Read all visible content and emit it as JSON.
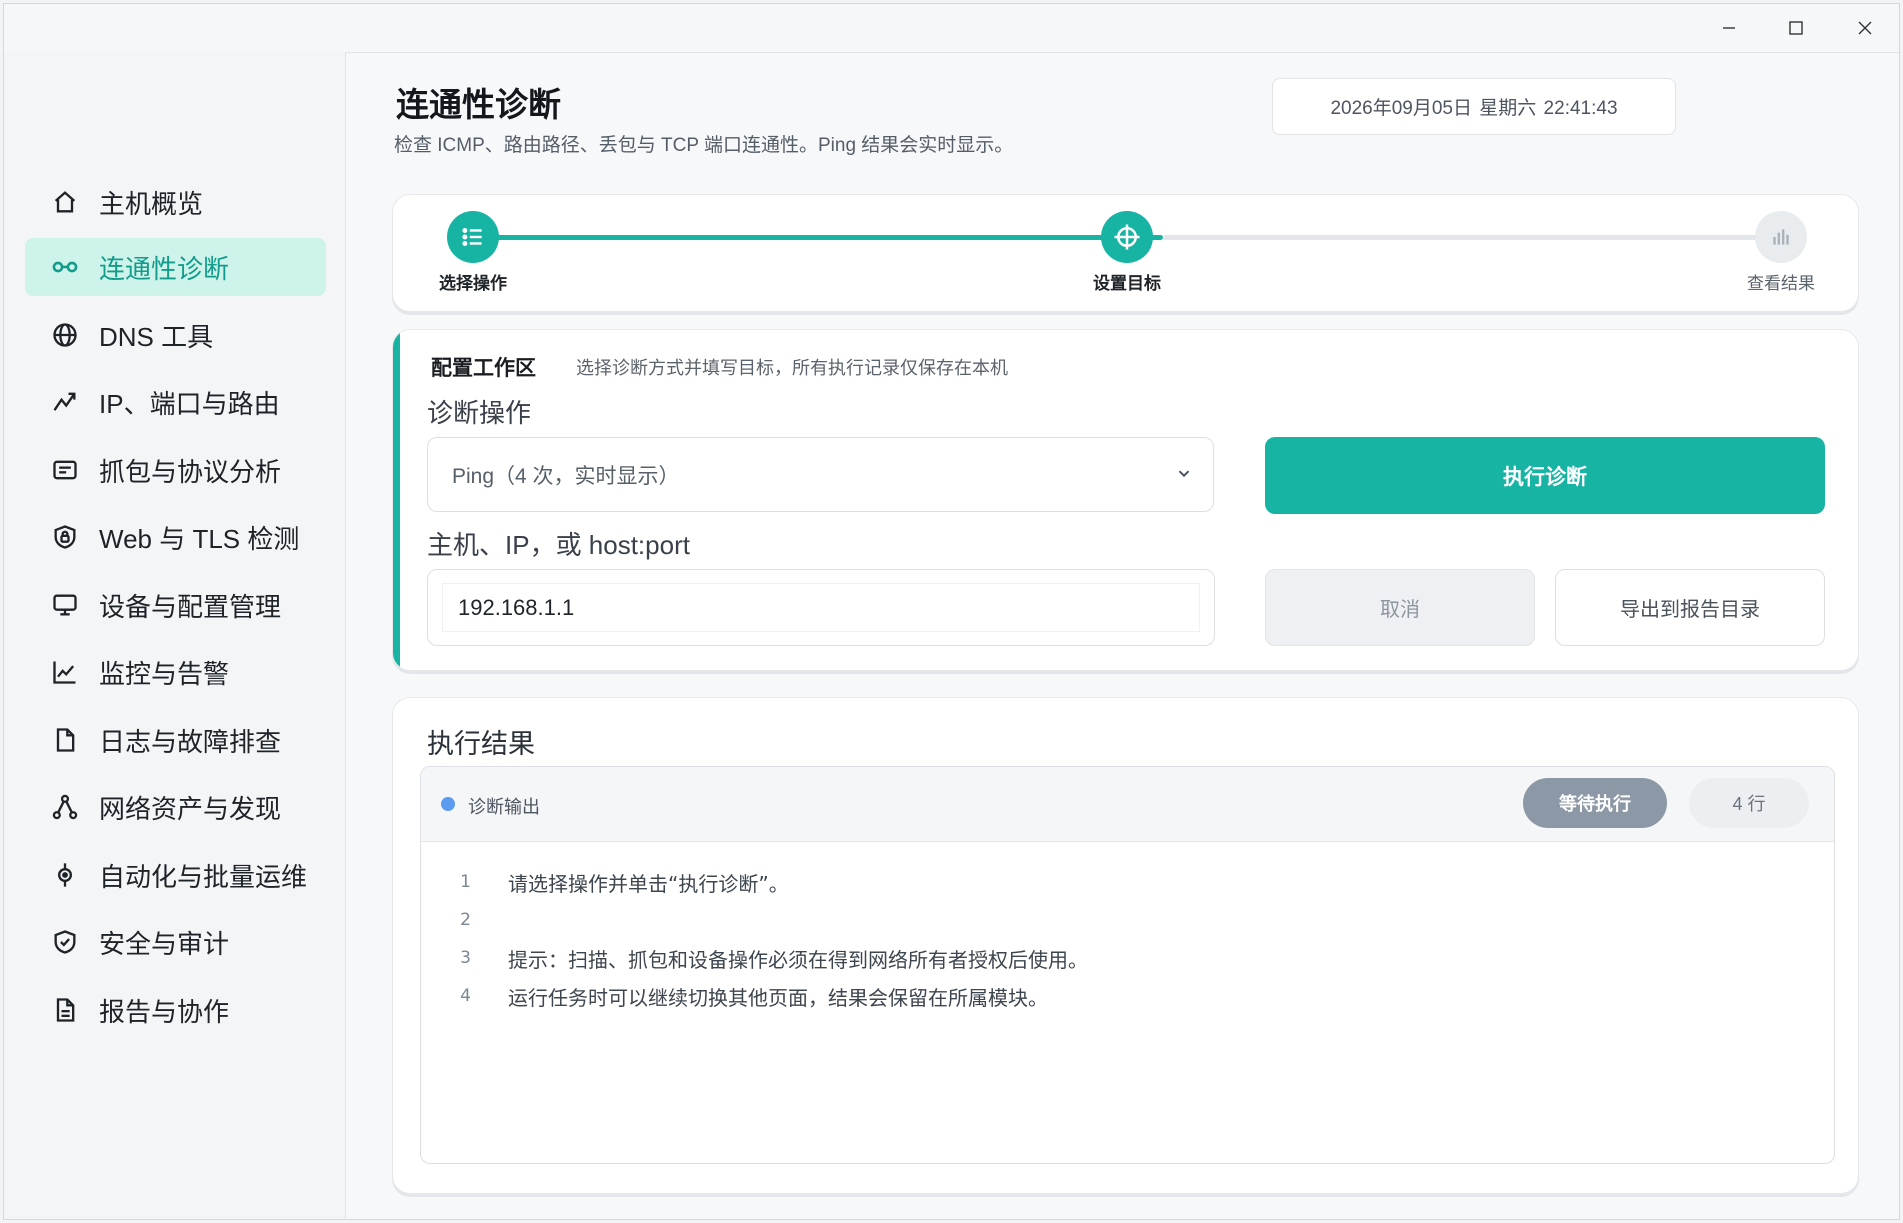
{
  "window": {
    "controls": [
      "minimize-icon",
      "maximize-icon",
      "close-icon"
    ]
  },
  "sidebar": {
    "items": [
      {
        "label": "主机概览",
        "icon": "home-icon",
        "active": false
      },
      {
        "label": "连通性诊断",
        "icon": "link-icon",
        "active": true
      },
      {
        "label": "DNS 工具",
        "icon": "globe-icon",
        "active": false
      },
      {
        "label": "IP、端口与路由",
        "icon": "route-icon",
        "active": false
      },
      {
        "label": "抓包与协议分析",
        "icon": "packet-icon",
        "active": false
      },
      {
        "label": "Web 与 TLS 检测",
        "icon": "shield-lock-icon",
        "active": false
      },
      {
        "label": "设备与配置管理",
        "icon": "monitor-icon",
        "active": false
      },
      {
        "label": "监控与告警",
        "icon": "chart-line-icon",
        "active": false
      },
      {
        "label": "日志与故障排查",
        "icon": "file-icon",
        "active": false
      },
      {
        "label": "网络资产与发现",
        "icon": "network-icon",
        "active": false
      },
      {
        "label": "自动化与批量运维",
        "icon": "target-icon",
        "active": false
      },
      {
        "label": "安全与审计",
        "icon": "shield-check-icon",
        "active": false
      },
      {
        "label": "报告与协作",
        "icon": "document-icon",
        "active": false
      }
    ]
  },
  "header": {
    "title": "连通性诊断",
    "subtitle": "检查 ICMP、路由路径、丢包与 TCP 端口连通性。Ping 结果会实时显示。",
    "datetime": "2026年09月05日   星期六   22:41:43"
  },
  "stepper": {
    "steps": [
      {
        "label": "选择操作",
        "icon": "list-icon",
        "state": "done"
      },
      {
        "label": "设置目标",
        "icon": "crosshair-icon",
        "state": "current"
      },
      {
        "label": "查看结果",
        "icon": "bar-chart-icon",
        "state": "pending"
      }
    ],
    "accent": "#17b4a3"
  },
  "config": {
    "title": "配置工作区",
    "description": "选择诊断方式并填写目标，所有执行记录仅保存在本机",
    "operation_label": "诊断操作",
    "operation_value": "Ping（4 次，实时显示）",
    "target_label": "主机、IP，或 host:port",
    "target_value": "192.168.1.1",
    "run_button": "执行诊断",
    "cancel_button": "取消",
    "export_button": "导出到报告目录"
  },
  "results": {
    "title": "执行结果",
    "output_label": "诊断输出",
    "status": "等待执行",
    "line_count": "4 行",
    "lines": [
      {
        "n": "1",
        "text": "请选择操作并单击“执行诊断”。"
      },
      {
        "n": "2",
        "text": ""
      },
      {
        "n": "3",
        "text": "提示：扫描、抓包和设备操作必须在得到网络所有者授权后使用。"
      },
      {
        "n": "4",
        "text": "运行任务时可以继续切换其他页面，结果会保留在所属模块。"
      }
    ]
  }
}
